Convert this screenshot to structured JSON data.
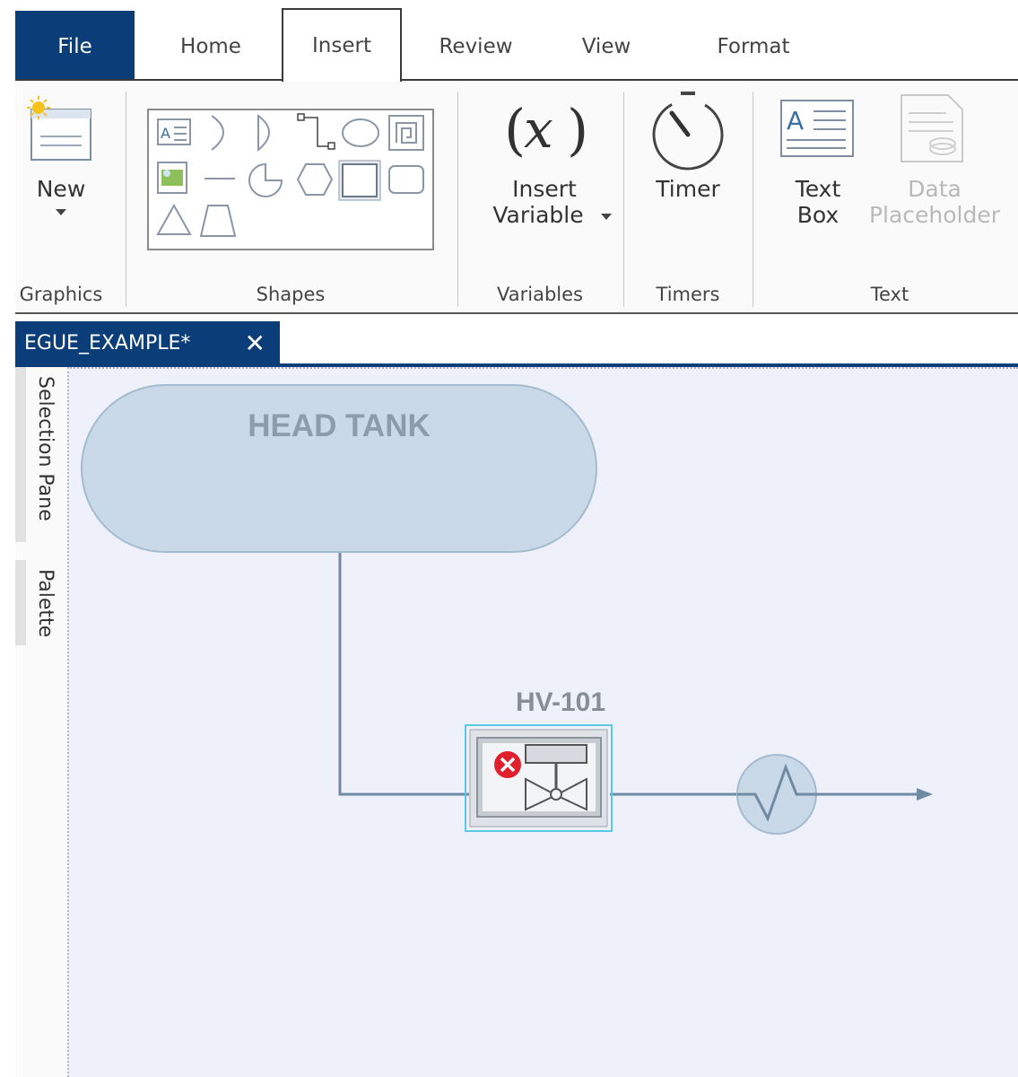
{
  "tabs": [
    {
      "label": "File"
    },
    {
      "label": "Home"
    },
    {
      "label": "Insert"
    },
    {
      "label": "Review"
    },
    {
      "label": "View"
    },
    {
      "label": "Format"
    }
  ],
  "active_tab": "Insert",
  "ribbon": {
    "graphics": {
      "group_label": "Graphics",
      "new_label": "New"
    },
    "shapes": {
      "group_label": "Shapes"
    },
    "variables": {
      "group_label": "Variables",
      "insert_line1": "Insert",
      "insert_line2": "Variable"
    },
    "timers": {
      "group_label": "Timers",
      "timer_label": "Timer"
    },
    "text": {
      "group_label": "Text",
      "textbox_line1": "Text",
      "textbox_line2": "Box",
      "data_line1": "Data",
      "data_line2": "Placeholder"
    }
  },
  "document_tab": {
    "title": "EGUE_EXAMPLE*",
    "close_glyph": "✕"
  },
  "side_panels": {
    "selection_pane": "Selection Pane",
    "palette": "Palette"
  },
  "canvas": {
    "tank_label": "HEAD TANK",
    "valve_tag": "HV-101"
  },
  "colors": {
    "file_tab": "#0b3d78",
    "canvas_bg": "#eef1f9",
    "tank_fill": "#c9d9e8",
    "selection_outline": "#5bc8e6",
    "error_badge": "#e0202d",
    "pipe": "#6f8aa2"
  }
}
